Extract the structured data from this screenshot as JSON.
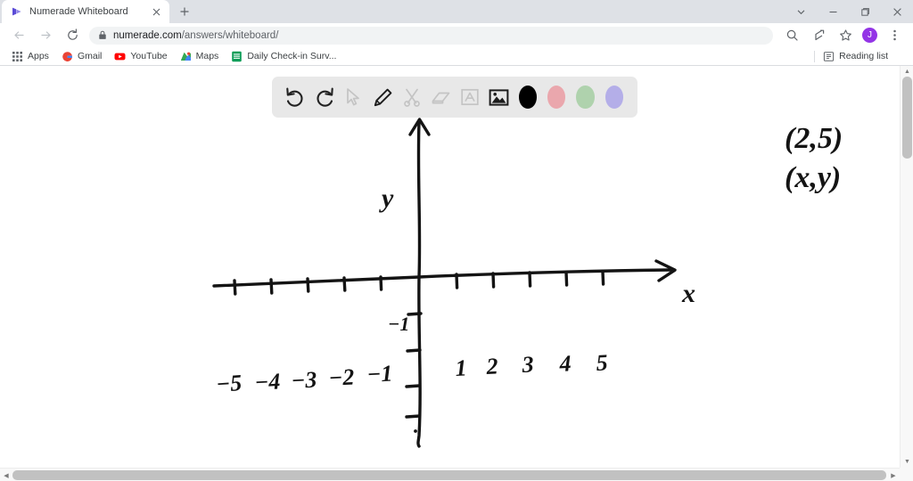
{
  "browser": {
    "tab": {
      "title": "Numerade Whiteboard",
      "favicon_icon": "numerade-logo-icon",
      "close_icon": "close-icon"
    },
    "new_tab_label": "+",
    "window_controls": [
      {
        "name": "tab-search-button",
        "icon": "chevron-down-icon"
      },
      {
        "name": "minimize-button",
        "icon": "minimize-icon"
      },
      {
        "name": "maximize-button",
        "icon": "maximize-icon"
      },
      {
        "name": "close-window-button",
        "icon": "close-icon"
      }
    ],
    "nav": {
      "back_icon": "back-arrow-icon",
      "forward_icon": "forward-arrow-icon",
      "reload_icon": "reload-icon",
      "lock_icon": "lock-icon",
      "url_domain": "numerade.com",
      "url_path": "/answers/whiteboard/",
      "url_full": "numerade.com/answers/whiteboard/",
      "search_icon": "search-icon",
      "share_icon": "share-icon",
      "bookmark_icon": "star-icon",
      "avatar_letter": "J",
      "menu_icon": "three-dot-menu-icon"
    },
    "bookmarks": [
      {
        "label": "Apps",
        "icon": "apps-grid-icon"
      },
      {
        "label": "Gmail",
        "icon": "gmail-icon"
      },
      {
        "label": "YouTube",
        "icon": "youtube-icon"
      },
      {
        "label": "Maps",
        "icon": "maps-icon"
      },
      {
        "label": "Daily Check-in Surv...",
        "icon": "sheets-icon"
      }
    ],
    "reading_list": {
      "label": "Reading list",
      "icon": "reading-list-icon"
    }
  },
  "whiteboard": {
    "toolbar": {
      "tools": [
        {
          "name": "undo-button",
          "icon": "undo-icon",
          "state": "enabled"
        },
        {
          "name": "redo-button",
          "icon": "redo-icon",
          "state": "enabled"
        },
        {
          "name": "select-tool",
          "icon": "cursor-icon",
          "state": "disabled"
        },
        {
          "name": "pencil-tool",
          "icon": "pencil-icon",
          "state": "enabled"
        },
        {
          "name": "scissors-tool",
          "icon": "scissors-icon",
          "state": "disabled"
        },
        {
          "name": "eraser-tool",
          "icon": "eraser-icon",
          "state": "disabled"
        },
        {
          "name": "text-tool",
          "icon": "text-box-icon",
          "state": "disabled"
        },
        {
          "name": "image-tool",
          "icon": "image-icon",
          "state": "enabled"
        }
      ],
      "colors": [
        {
          "name": "color-black",
          "hex": "#000000",
          "selected": true
        },
        {
          "name": "color-pink",
          "hex": "#eaa7ad",
          "selected": false
        },
        {
          "name": "color-green",
          "hex": "#afd2ad",
          "selected": false
        },
        {
          "name": "color-purple",
          "hex": "#b4aee8",
          "selected": false
        }
      ]
    },
    "annotations": {
      "point_coordinates": "(2,5)",
      "generic_coordinates": "(x,y)"
    }
  },
  "chart_data": {
    "type": "line",
    "title": "",
    "xlabel": "x",
    "ylabel": "y",
    "xlim": [
      -6,
      7
    ],
    "ylim": [
      -5,
      8
    ],
    "grid": false,
    "x_tick_labels": [
      "-5",
      "-4",
      "-3",
      "-2",
      "-1",
      "1",
      "2",
      "3",
      "4",
      "5"
    ],
    "x_tick_values": [
      -5,
      -4,
      -3,
      -2,
      -1,
      1,
      2,
      3,
      4,
      5
    ],
    "y_tick_labels": [
      "-1"
    ],
    "y_tick_values": [
      -1
    ],
    "y_negative_tick_count": 4,
    "annotations": [
      {
        "text": "(2,5)",
        "x": 9.6,
        "y": 7.2
      },
      {
        "text": "(x,y)",
        "x": 9.6,
        "y": 5.9
      }
    ],
    "series": [],
    "description": "Hand-drawn cartesian coordinate axes: horizontal x-axis with arrowhead pointing right labeled x, vertical y-axis with arrowhead pointing up labeled y. Negative x ticks labeled -5 through -1, positive x ticks labeled 1 through 5, one labeled y tick at -1."
  }
}
